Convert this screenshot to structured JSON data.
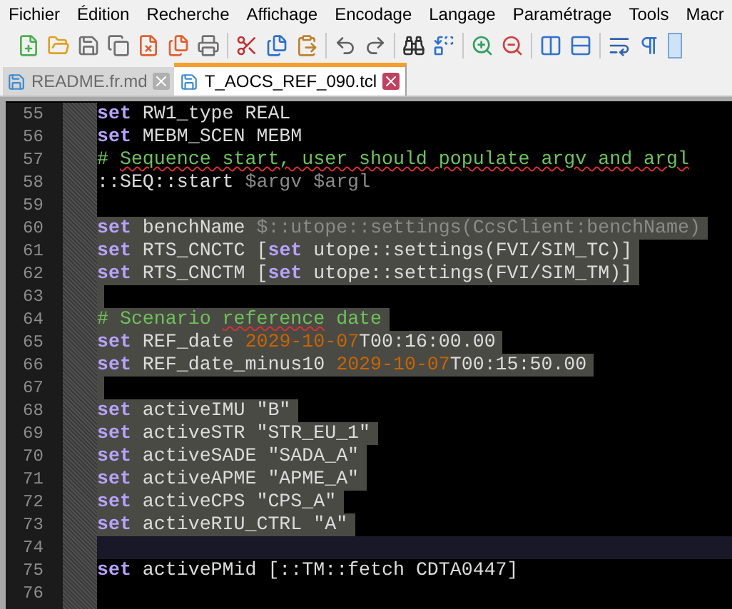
{
  "menu": [
    "Fichier",
    "Édition",
    "Recherche",
    "Affichage",
    "Encodage",
    "Langage",
    "Paramétrage",
    "Tools",
    "Macr"
  ],
  "tabs": [
    {
      "label": "README.fr.md",
      "selected": false
    },
    {
      "label": "T_AOCS_REF_090.tcl",
      "selected": true
    }
  ],
  "editor": {
    "lines": [
      {
        "number": "55",
        "selected": false,
        "current": false,
        "tokens": [
          {
            "kind": "keyword",
            "text": "set"
          },
          {
            "kind": "text",
            "text": " RW1_type REAL"
          }
        ]
      },
      {
        "number": "56",
        "selected": false,
        "current": false,
        "tokens": [
          {
            "kind": "keyword",
            "text": "set"
          },
          {
            "kind": "text",
            "text": " MEBM_SCEN MEBM"
          }
        ]
      },
      {
        "number": "57",
        "selected": false,
        "current": false,
        "tokens": [
          {
            "kind": "comment",
            "text": "# "
          },
          {
            "kind": "comment_flagged",
            "text": "Sequence start, user should populate argv and argl"
          }
        ]
      },
      {
        "number": "58",
        "selected": false,
        "current": false,
        "tokens": [
          {
            "kind": "text",
            "text": "::SEQ::start "
          },
          {
            "kind": "variable",
            "text": "$argv $argl"
          }
        ]
      },
      {
        "number": "59",
        "selected": false,
        "current": false
      },
      {
        "number": "60",
        "selected": true,
        "current": false,
        "tokens": [
          {
            "kind": "keyword",
            "text": "set"
          },
          {
            "kind": "text",
            "text": " benchName "
          },
          {
            "kind": "variable",
            "text": "$::utope::settings(CcsClient:benchName)"
          }
        ]
      },
      {
        "number": "61",
        "selected": true,
        "current": false,
        "tokens": [
          {
            "kind": "keyword",
            "text": "set"
          },
          {
            "kind": "text",
            "text": " RTS_CNCTC ["
          },
          {
            "kind": "keyword",
            "text": "set"
          },
          {
            "kind": "text",
            "text": " utope::settings(FVI/SIM_TC)]"
          }
        ]
      },
      {
        "number": "62",
        "selected": true,
        "current": false,
        "tokens": [
          {
            "kind": "keyword",
            "text": "set"
          },
          {
            "kind": "text",
            "text": " RTS_CNCTM ["
          },
          {
            "kind": "keyword",
            "text": "set"
          },
          {
            "kind": "text",
            "text": " utope::settings(FVI/SIM_TM)]"
          }
        ]
      },
      {
        "number": "63",
        "selected": true,
        "current": false
      },
      {
        "number": "64",
        "selected": true,
        "current": false,
        "tokens": [
          {
            "kind": "comment",
            "text": "# Scenario "
          },
          {
            "kind": "comment_flagged",
            "text": "reference"
          },
          {
            "kind": "comment",
            "text": " date"
          }
        ]
      },
      {
        "number": "65",
        "selected": true,
        "current": false,
        "tokens": [
          {
            "kind": "keyword",
            "text": "set"
          },
          {
            "kind": "text",
            "text": " REF_date "
          },
          {
            "kind": "number",
            "text": "2029-10-07"
          },
          {
            "kind": "text",
            "text": "T00:16:00.00"
          }
        ]
      },
      {
        "number": "66",
        "selected": true,
        "current": false,
        "tokens": [
          {
            "kind": "keyword",
            "text": "set"
          },
          {
            "kind": "text",
            "text": " REF_date_minus10 "
          },
          {
            "kind": "number",
            "text": "2029-10-07"
          },
          {
            "kind": "text",
            "text": "T00:15:50.00"
          }
        ]
      },
      {
        "number": "67",
        "selected": true,
        "current": false
      },
      {
        "number": "68",
        "selected": true,
        "current": false,
        "tokens": [
          {
            "kind": "keyword",
            "text": "set"
          },
          {
            "kind": "text",
            "text": " activeIMU \"B\""
          }
        ]
      },
      {
        "number": "69",
        "selected": true,
        "current": false,
        "tokens": [
          {
            "kind": "keyword",
            "text": "set"
          },
          {
            "kind": "text",
            "text": " activeSTR \"STR_EU_1\""
          }
        ]
      },
      {
        "number": "70",
        "selected": true,
        "current": false,
        "tokens": [
          {
            "kind": "keyword",
            "text": "set"
          },
          {
            "kind": "text",
            "text": " activeSADE \"SADA_A\""
          }
        ]
      },
      {
        "number": "71",
        "selected": true,
        "current": false,
        "tokens": [
          {
            "kind": "keyword",
            "text": "set"
          },
          {
            "kind": "text",
            "text": " activeAPME \"APME_A\""
          }
        ]
      },
      {
        "number": "72",
        "selected": true,
        "current": false,
        "tokens": [
          {
            "kind": "keyword",
            "text": "set"
          },
          {
            "kind": "text",
            "text": " activeCPS \"CPS_A\""
          }
        ]
      },
      {
        "number": "73",
        "selected": true,
        "current": false,
        "tokens": [
          {
            "kind": "keyword",
            "text": "set"
          },
          {
            "kind": "text",
            "text": " activeRIU_CTRL \"A\""
          }
        ]
      },
      {
        "number": "74",
        "selected": false,
        "current": true
      },
      {
        "number": "75",
        "selected": false,
        "current": false,
        "tokens": [
          {
            "kind": "keyword",
            "text": "set"
          },
          {
            "kind": "text",
            "text": " activePMid [::TM::fetch CDTA0447]"
          }
        ]
      },
      {
        "number": "76",
        "selected": false,
        "current": false
      }
    ]
  }
}
